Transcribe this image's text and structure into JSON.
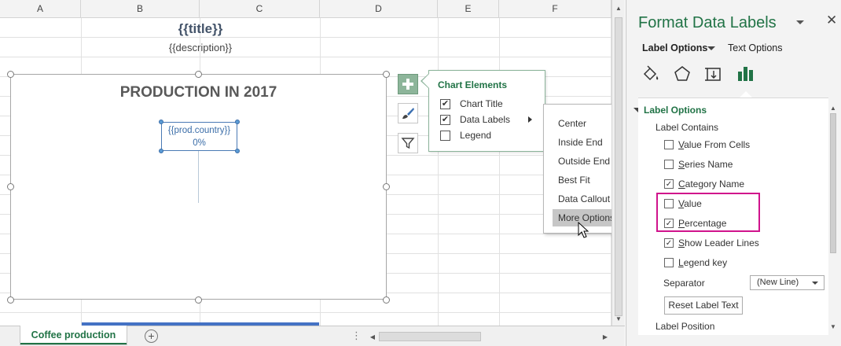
{
  "columns": [
    "A",
    "B",
    "C",
    "D",
    "E",
    "F"
  ],
  "cells": {
    "title": "{{title}}",
    "description": "{{description}}"
  },
  "chart": {
    "title": "PRODUCTION IN 2017",
    "data_label_line1": "{{prod.country}}",
    "data_label_line2": "0%"
  },
  "chart_buttons": {
    "elements": "plus-icon",
    "styles": "brush-icon",
    "filters": "funnel-icon"
  },
  "chart_elements": {
    "title": "Chart Elements",
    "items": [
      {
        "label": "Chart Title",
        "checked": true,
        "check": "✔"
      },
      {
        "label": "Data Labels",
        "checked": true,
        "check": "✔"
      },
      {
        "label": "Legend",
        "checked": false,
        "check": ""
      }
    ]
  },
  "data_label_submenu": {
    "items": [
      "Center",
      "Inside End",
      "Outside End",
      "Best Fit",
      "Data Callout",
      "More Options..."
    ],
    "highlighted": "More Options..."
  },
  "sheet_tabs": {
    "active": "Coffee production",
    "add": "+",
    "dots": "⋮"
  },
  "pane": {
    "title": "Format Data Labels",
    "close": "✕",
    "tab_label_options": "Label Options",
    "tab_text_options": "Text Options",
    "section_title": "Label Options",
    "label_contains": "Label Contains",
    "options": [
      {
        "label": "Value From Cells",
        "checked": false,
        "check": ""
      },
      {
        "label": "Series Name",
        "checked": false,
        "check": ""
      },
      {
        "label": "Category Name",
        "checked": true,
        "check": "✓"
      },
      {
        "label": "Value",
        "checked": false,
        "check": ""
      },
      {
        "label": "Percentage",
        "checked": true,
        "check": "✓"
      },
      {
        "label": "Show Leader Lines",
        "checked": true,
        "check": "✓"
      },
      {
        "label": "Legend key",
        "checked": false,
        "check": ""
      }
    ],
    "separator_label": "Separator",
    "separator_value": "(New Line)",
    "reset_button": "Reset Label Text",
    "label_position": "Label Position",
    "highlight_color": "#d0138c",
    "accent_color": "#217346"
  }
}
